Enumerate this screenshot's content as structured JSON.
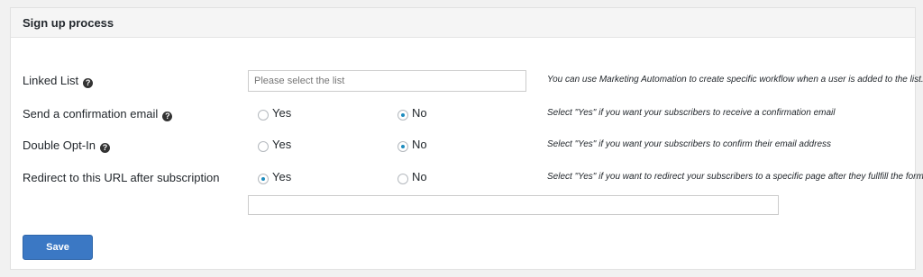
{
  "section": {
    "title": "Sign up process"
  },
  "linked_list": {
    "label": "Linked List",
    "placeholder": "Please select the list",
    "description": "You can use Marketing Automation to create specific workflow when a user is added to the list."
  },
  "confirmation_email": {
    "label": "Send a confirmation email",
    "yes_label": "Yes",
    "no_label": "No",
    "selected": "No",
    "description": "Select \"Yes\" if you want your subscribers to receive a confirmation email"
  },
  "double_optin": {
    "label": "Double Opt-In",
    "yes_label": "Yes",
    "no_label": "No",
    "selected": "No",
    "description": "Select \"Yes\" if you want your subscribers to confirm their email address"
  },
  "redirect": {
    "label": "Redirect to this URL after subscription",
    "yes_label": "Yes",
    "no_label": "No",
    "selected": "Yes",
    "description": "Select \"Yes\" if you want to redirect your subscribers to a specific page after they fullfill the form",
    "url_value": ""
  },
  "actions": {
    "save_label": "Save"
  },
  "icons": {
    "help": "question-circle-icon"
  },
  "colors": {
    "primary": "#3b78c4",
    "radio_checked": "#1e8cbe"
  }
}
